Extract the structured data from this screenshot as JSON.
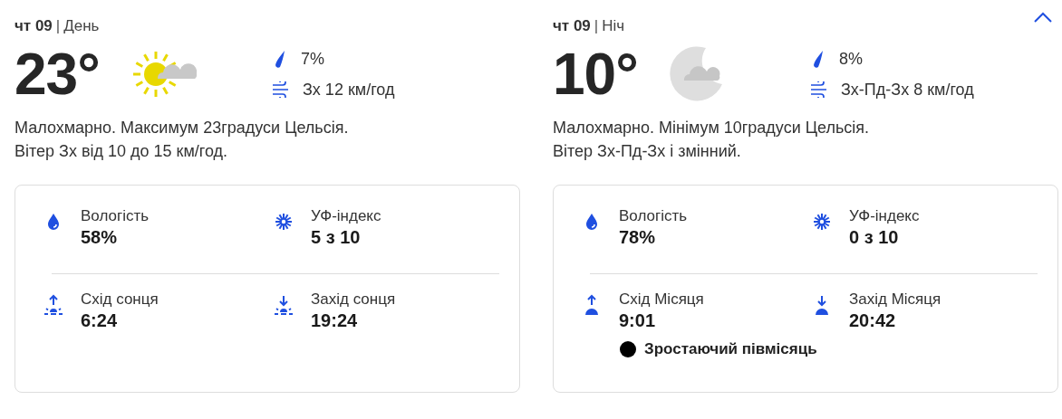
{
  "expanded": true,
  "panels": [
    {
      "kind": "day",
      "day": "чт 09",
      "separator": "|",
      "period": "День",
      "temperature": "23°",
      "precipitation": "7%",
      "wind": "Зх 12 км/год",
      "description": [
        "Малохмарно. Максимум 23градуси Цельсія.",
        "Вітер Зх від 10 до 15 км/год."
      ],
      "rows": [
        [
          {
            "kind": "humidity",
            "label": "Вологість",
            "value": "58%"
          },
          {
            "kind": "uv",
            "label": "УФ-індекс",
            "value": "5 з 10"
          }
        ],
        [
          {
            "kind": "sunrise",
            "label": "Схід сонця",
            "value": "6:24"
          },
          {
            "kind": "sunset",
            "label": "Захід сонця",
            "value": "19:24"
          }
        ]
      ]
    },
    {
      "kind": "night",
      "day": "чт 09",
      "separator": "|",
      "period": "Ніч",
      "temperature": "10°",
      "precipitation": "8%",
      "wind": "Зх-Пд-Зх 8 км/год",
      "description": [
        "Малохмарно. Мінімум 10градуси Цельсія.",
        "Вітер Зх-Пд-Зх і змінний."
      ],
      "rows": [
        [
          {
            "kind": "humidity",
            "label": "Вологість",
            "value": "78%"
          },
          {
            "kind": "uv",
            "label": "УФ-індекс",
            "value": "0 з 10"
          }
        ],
        [
          {
            "kind": "moonrise",
            "label": "Схід Місяця",
            "value": "9:01"
          },
          {
            "kind": "moonset",
            "label": "Захід Місяця",
            "value": "20:42"
          }
        ]
      ],
      "moon_phase": "Зростаючий півмісяць"
    }
  ]
}
